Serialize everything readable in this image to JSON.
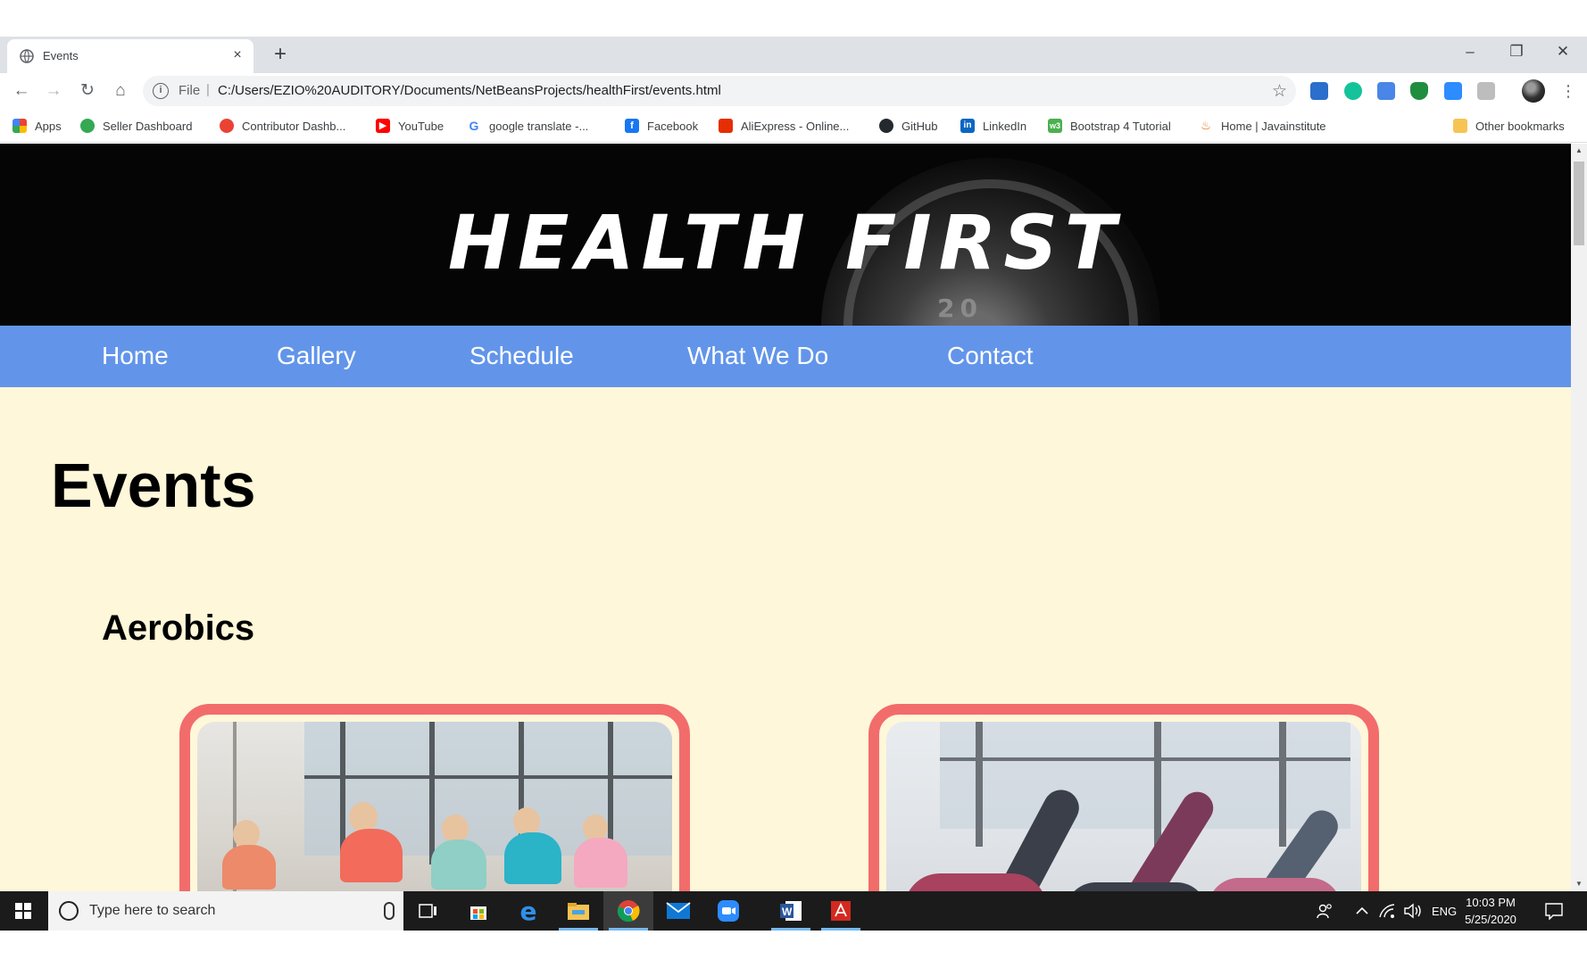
{
  "browser": {
    "tab_title": "Events",
    "tab_close": "×",
    "new_tab": "+",
    "window_controls": {
      "minimize": "–",
      "restore": "❐",
      "close": "✕"
    },
    "nav": {
      "back": "←",
      "forward": "→",
      "reload": "↻",
      "home": "⌂"
    },
    "omnibox": {
      "info": "i",
      "scheme": "File",
      "separator": "|",
      "url": "C:/Users/EZIO%20AUDITORY/Documents/NetBeansProjects/healthFirst/events.html",
      "star": "☆"
    },
    "menu": "⋮",
    "bookmarks": [
      {
        "label": "Apps",
        "icon": "apps-grid-icon",
        "color": "#4285f4"
      },
      {
        "label": "Seller Dashboard",
        "icon": "seller-dashboard-icon",
        "color": "#34a853"
      },
      {
        "label": "Contributor Dashb...",
        "icon": "contributor-icon",
        "color": "#ea4335"
      },
      {
        "label": "YouTube",
        "icon": "youtube-icon",
        "color": "#ff0000"
      },
      {
        "label": "google translate -...",
        "icon": "google-icon",
        "color": "#4285f4"
      },
      {
        "label": "Facebook",
        "icon": "facebook-icon",
        "color": "#1877f2"
      },
      {
        "label": "AliExpress - Online...",
        "icon": "aliexpress-icon",
        "color": "#e62e04"
      },
      {
        "label": "GitHub",
        "icon": "github-icon",
        "color": "#24292e"
      },
      {
        "label": "LinkedIn",
        "icon": "linkedin-icon",
        "color": "#0a66c2"
      },
      {
        "label": "Bootstrap 4 Tutorial",
        "icon": "w3-icon",
        "color": "#4caf50"
      },
      {
        "label": "Home | Javainstitute",
        "icon": "java-icon",
        "color": "#e76f00"
      },
      {
        "label": "Other bookmarks",
        "icon": "folder-icon",
        "color": "#f6c453"
      }
    ]
  },
  "site": {
    "brand": "HEALTH FIRST",
    "plate_text": "20",
    "nav": [
      "Home",
      "Gallery",
      "Schedule",
      "What We Do",
      "Contact"
    ],
    "page_title": "Events",
    "section_title": "Aerobics",
    "colors": {
      "nav_bg": "#6295ea",
      "page_bg": "#fef7d9",
      "card_border": "#f26c6c"
    }
  },
  "taskbar": {
    "search_placeholder": "Type here to search",
    "language": "ENG",
    "time": "10:03 PM",
    "date": "5/25/2020",
    "apps": [
      "task-view-icon",
      "store-icon",
      "edge-icon",
      "file-explorer-icon",
      "chrome-icon",
      "mail-icon",
      "zoom-icon",
      "word-icon",
      "acrobat-icon"
    ]
  }
}
